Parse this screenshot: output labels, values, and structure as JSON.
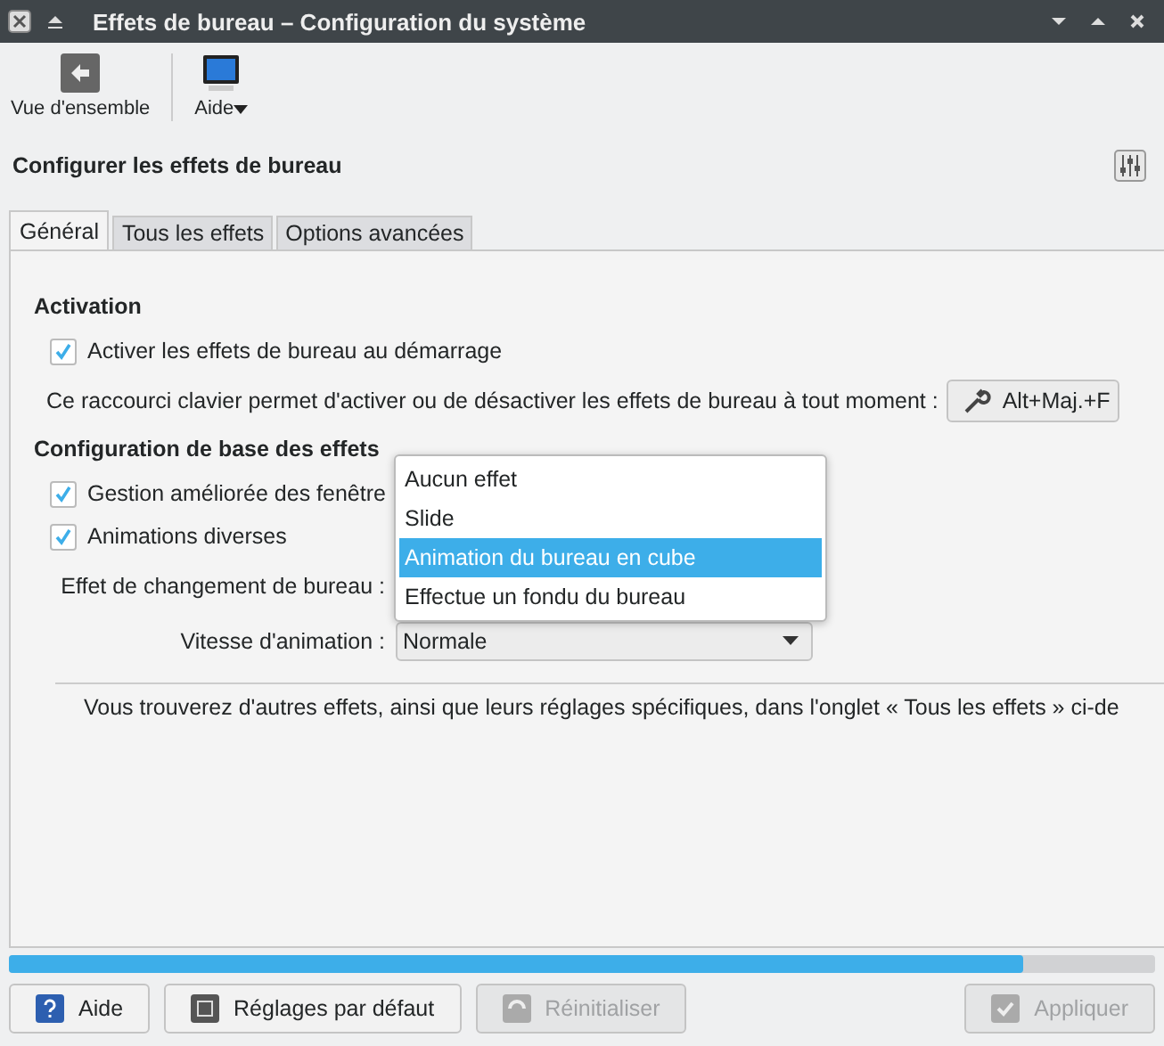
{
  "window": {
    "title": "Effets de bureau – Configuration du système"
  },
  "toolbar": [
    {
      "kind": "back",
      "label": "Vue d'ensemble"
    },
    {
      "kind": "monitor",
      "label": "Aide"
    }
  ],
  "heading": "Configurer les effets de bureau",
  "tabs": [
    {
      "label": "Général",
      "selected": true
    },
    {
      "label": "Tous les effets",
      "selected": false
    },
    {
      "label": "Options avancées",
      "selected": false
    }
  ],
  "activation": {
    "title": "Activation",
    "checkbox": {
      "label": "Activer les effets de bureau au démarrage",
      "checked": true
    },
    "shortcut_label": "Ce raccourci clavier permet d'activer ou de désactiver les effets de bureau à tout moment :",
    "shortcut": "Alt+Maj.+F"
  },
  "basic": {
    "title": "Configuration de base des effets",
    "checkboxes": [
      {
        "label": "Gestion améliorée des fenêtre",
        "checked": true
      },
      {
        "label": "Animations diverses",
        "checked": true
      }
    ],
    "switch_label": "Effet de changement de bureau :",
    "speed_label": "Vitesse d'animation :",
    "speed_value": "Normale"
  },
  "popup": [
    {
      "label": "Aucun effet",
      "selected": false
    },
    {
      "label": "Slide",
      "selected": false
    },
    {
      "label": "Animation du bureau en cube",
      "selected": true
    },
    {
      "label": "Effectue un fondu du bureau",
      "selected": false
    }
  ],
  "note": "Vous trouverez d'autres effets, ainsi que leurs réglages spécifiques, dans l'onglet « Tous les effets » ci-de",
  "progress": {
    "level": 0.885
  },
  "buttons": [
    {
      "kind": "help",
      "label": "Aide",
      "disabled": false
    },
    {
      "kind": "defaults",
      "label": "Réglages par défaut",
      "disabled": false
    },
    {
      "kind": "reset",
      "label": "Réinitialiser",
      "disabled": true
    },
    {
      "kind": "apply",
      "label": "Appliquer",
      "disabled": true
    }
  ]
}
